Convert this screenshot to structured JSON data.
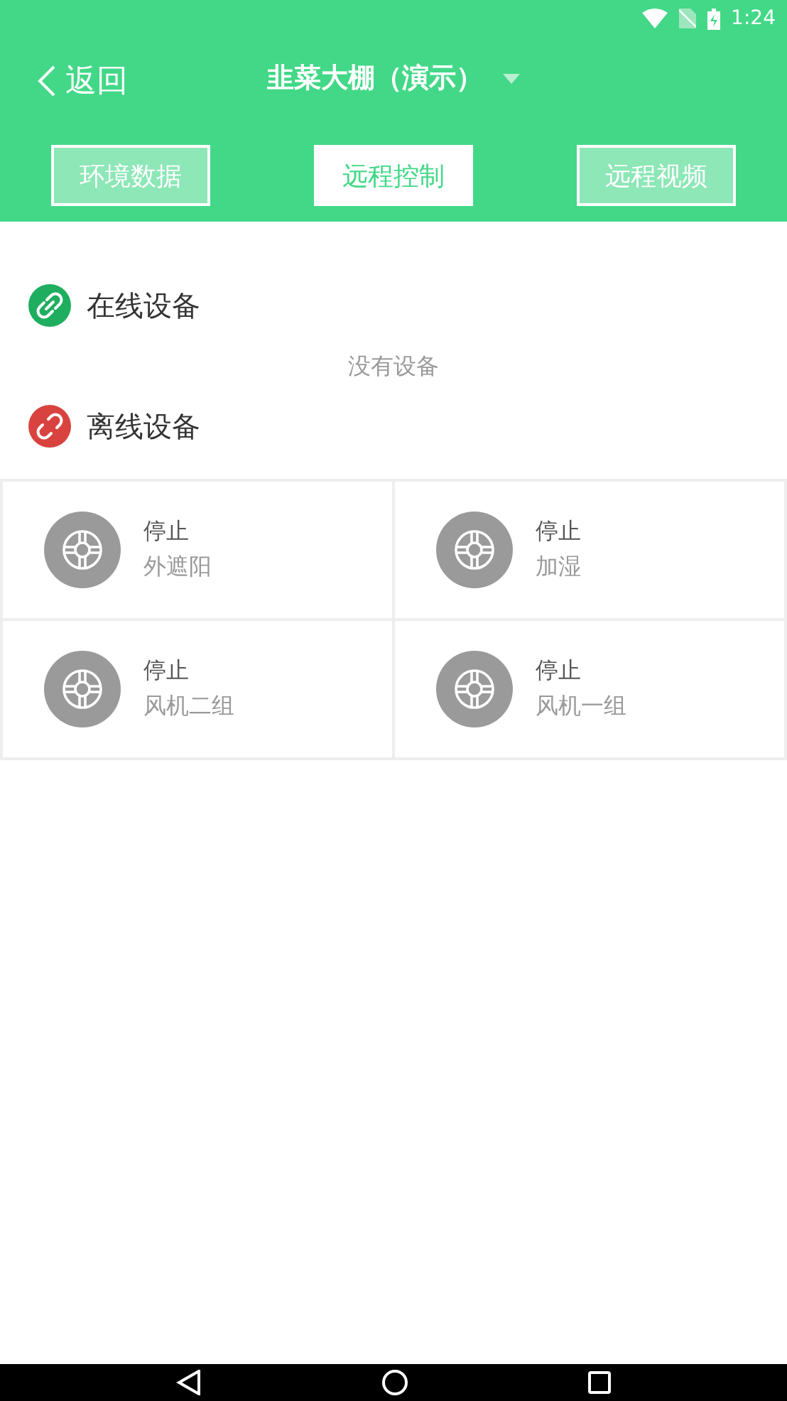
{
  "status_bar": {
    "time": "1:24"
  },
  "header": {
    "back": "返回",
    "title": "韭菜大棚（演示）"
  },
  "tabs": [
    {
      "label": "环境数据",
      "selected": false
    },
    {
      "label": "远程控制",
      "selected": true
    },
    {
      "label": "远程视频",
      "selected": false
    }
  ],
  "sections": [
    {
      "kind": "online",
      "title": "在线设备",
      "empty_text": "没有设备"
    },
    {
      "kind": "offline",
      "title": "离线设备",
      "devices": [
        {
          "status": "停止",
          "name": "外遮阳"
        },
        {
          "status": "停止",
          "name": "加湿"
        },
        {
          "status": "停止",
          "name": "风机二组"
        },
        {
          "status": "停止",
          "name": "风机一组"
        }
      ]
    }
  ]
}
